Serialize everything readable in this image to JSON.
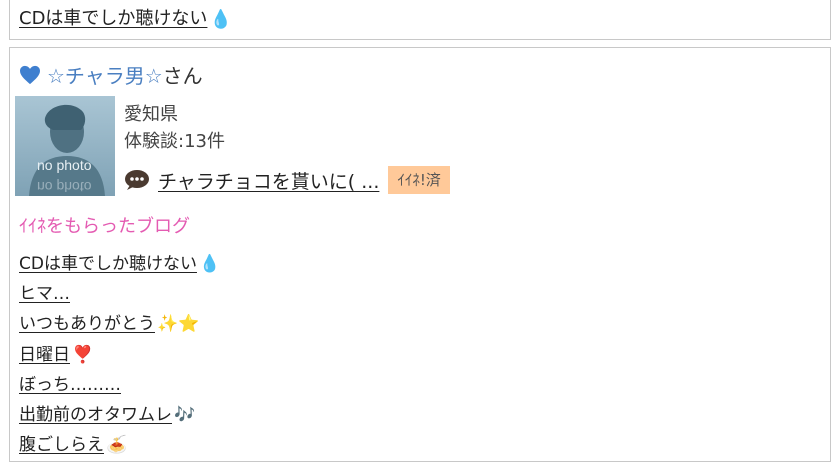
{
  "top_entry": {
    "blog_link": "CDは車でしか聴けない",
    "emoji": "💧"
  },
  "profile": {
    "heart_color": "#3f7fcf",
    "name": "☆チャラ男☆",
    "suffix": "さん",
    "photo_label": "no photo",
    "prefecture": "愛知県",
    "experience_count": "体験談:13件",
    "latest_post_title": "チャラチョコを貰いに( ...",
    "like_badge": "ｲｲﾈ!済"
  },
  "liked_blogs": {
    "heading": "ｲｲﾈをもらったブログ",
    "heading_color": "#e45bb2",
    "items": [
      {
        "label": "CDは車でしか聴けない",
        "emoji": "💧"
      },
      {
        "label": "ヒマ…",
        "emoji": ""
      },
      {
        "label": "いつもありがとう",
        "emoji": "✨⭐"
      },
      {
        "label": "日曜日",
        "emoji": "❣️"
      },
      {
        "label": "ぼっち………",
        "emoji": ""
      },
      {
        "label": "出勤前のオタワムレ",
        "emoji": "🎶"
      },
      {
        "label": "腹ごしらえ",
        "emoji": "🍝"
      }
    ]
  }
}
